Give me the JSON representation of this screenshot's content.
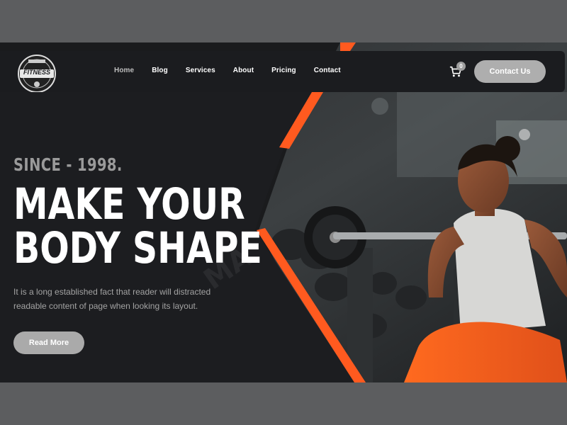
{
  "logo": {
    "text": "FITNESS",
    "icon": "dumbbell-badge"
  },
  "nav": {
    "items": [
      {
        "label": "Home",
        "active": true
      },
      {
        "label": "Blog"
      },
      {
        "label": "Services"
      },
      {
        "label": "About"
      },
      {
        "label": "Pricing"
      },
      {
        "label": "Contact"
      }
    ],
    "cart_count": "0",
    "contact_label": "Contact Us"
  },
  "hero": {
    "since": "SINCE - 1998.",
    "headline_line1": "MAKE YOUR",
    "headline_line2": "BODY SHAPE",
    "description": "It is a long established fact that reader will distracted readable content of page when looking its layout.",
    "read_more": "Read More"
  },
  "colors": {
    "accent": "#ff5a1f",
    "dark": "#1b1c1f",
    "button": "#aeaeae"
  }
}
